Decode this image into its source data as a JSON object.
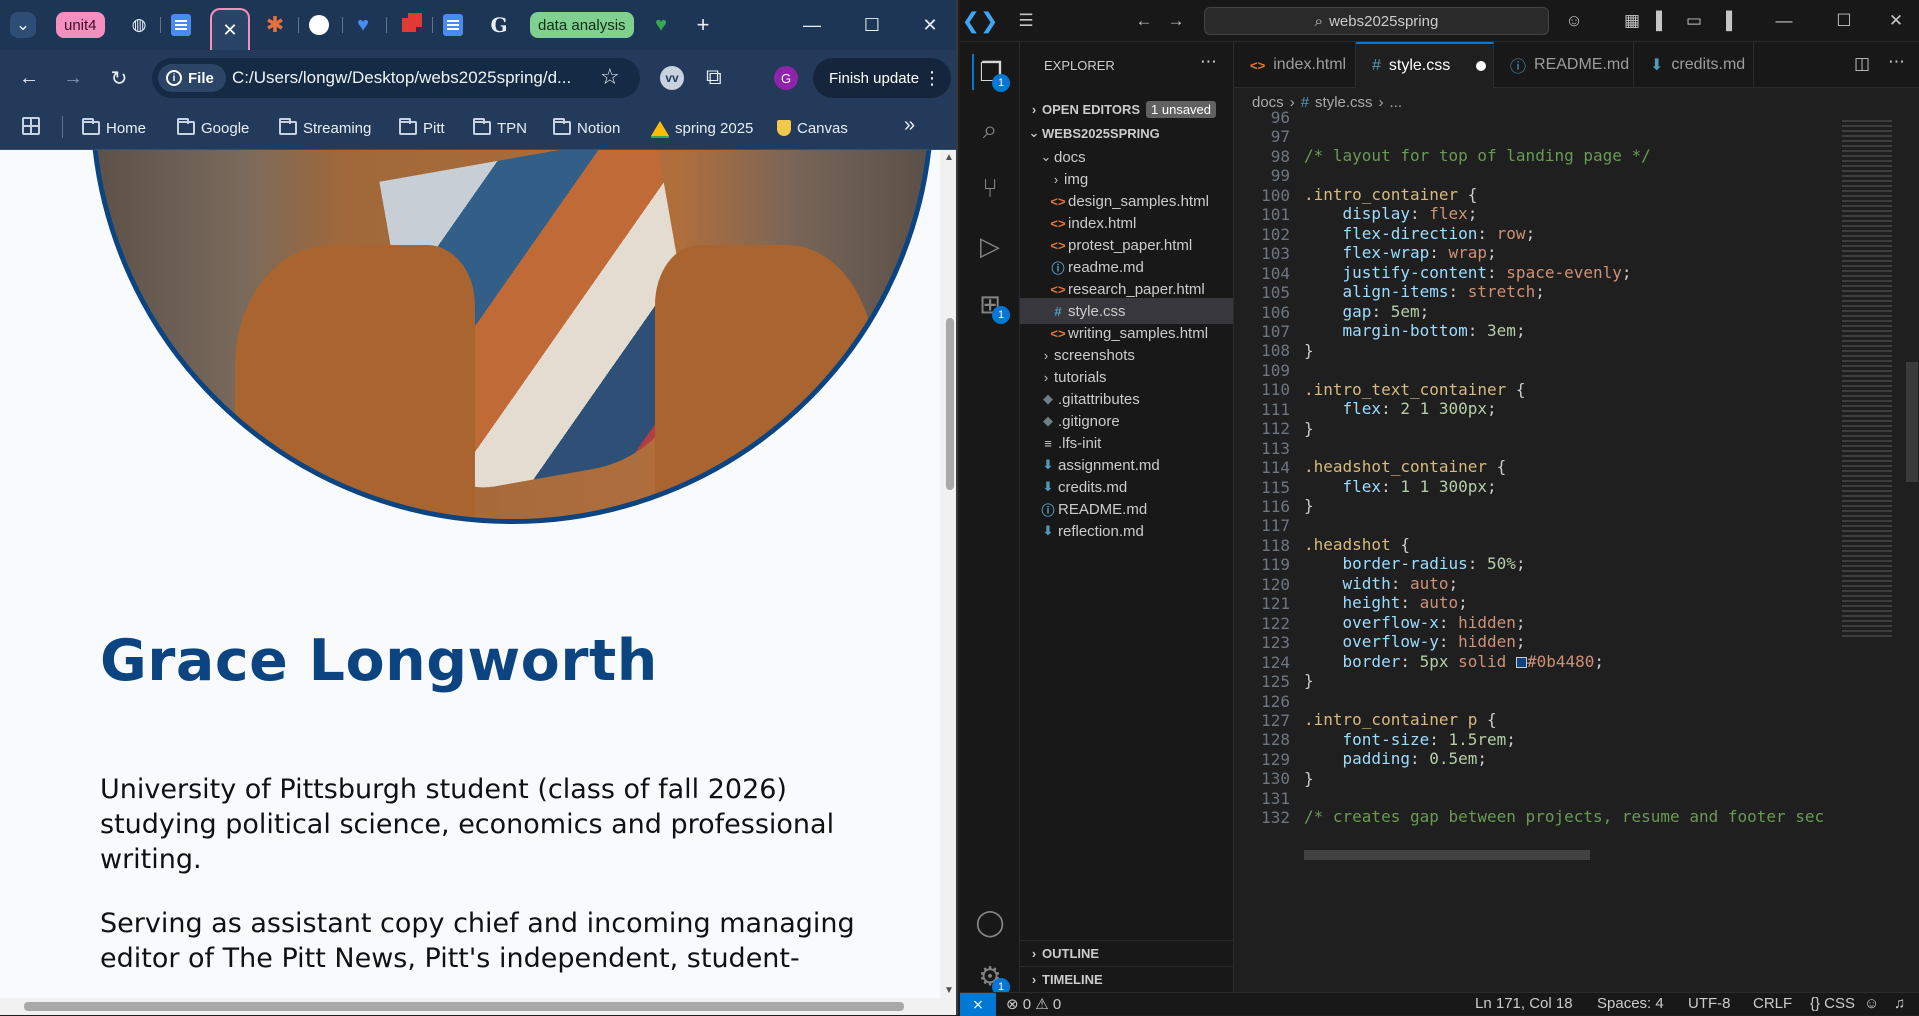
{
  "browser": {
    "tabs": {
      "group1": "unit4",
      "group2": "data analysis"
    },
    "url": "C:/Users/longw/Desktop/webs2025spring/d...",
    "file_chip": "File",
    "profile_letter": "G",
    "finish_update": "Finish update",
    "bookmarks": [
      "Home",
      "Google",
      "Streaming",
      "Pitt",
      "TPN",
      "Notion",
      "spring 2025",
      "Canvas"
    ],
    "page": {
      "name": "Grace Longworth",
      "p1": "University of Pittsburgh student (class of fall 2026) studying political science, economics and professional writing.",
      "p2": "Serving as assistant copy chief and incoming managing editor of The Pitt News, Pitt's independent, student-"
    },
    "colors": {
      "accent": "#0b4480",
      "tab_group1": "#f58fbf",
      "tab_group2": "#7fd091"
    }
  },
  "vscode": {
    "search": "webs2025spring",
    "sidebar": {
      "title": "EXPLORER",
      "open_editors": "OPEN EDITORS",
      "unsaved": "1 unsaved",
      "root": "WEBS2025SPRING",
      "docs": "docs",
      "img": "img",
      "files_docs": [
        "design_samples.html",
        "index.html",
        "protest_paper.html",
        "readme.md",
        "research_paper.html",
        "style.css",
        "writing_samples.html"
      ],
      "screenshots": "screenshots",
      "tutorials": "tutorials",
      "root_files": [
        ".gitattributes",
        ".gitignore",
        ".lfs-init",
        "assignment.md",
        "credits.md",
        "README.md",
        "reflection.md"
      ],
      "outline": "OUTLINE",
      "timeline": "TIMELINE"
    },
    "tabs": [
      "index.html",
      "style.css",
      "README.md",
      "credits.md"
    ],
    "breadcrumb": {
      "folder": "docs",
      "file": "style.css",
      "more": "..."
    },
    "line_numbers": [
      "96",
      "97",
      "98",
      "99",
      "100",
      "101",
      "102",
      "103",
      "104",
      "105",
      "106",
      "107",
      "108",
      "109",
      "110",
      "111",
      "112",
      "113",
      "114",
      "115",
      "116",
      "117",
      "118",
      "119",
      "120",
      "121",
      "122",
      "123",
      "124",
      "125",
      "126",
      "127",
      "128",
      "129",
      "130",
      "131",
      "132"
    ],
    "code": {
      "c97": "/* layout for top of landing page */",
      "c131": "/* creates gap between projects, resume and footer sec"
    },
    "status": {
      "problems": "⊗ 0 ⚠ 0",
      "position": "Ln 171, Col 18",
      "spaces": "Spaces: 4",
      "encoding": "UTF-8",
      "eol": "CRLF",
      "lang": "{} CSS"
    },
    "badges": {
      "explorer": "1",
      "extensions": "1",
      "settings": "1"
    }
  }
}
